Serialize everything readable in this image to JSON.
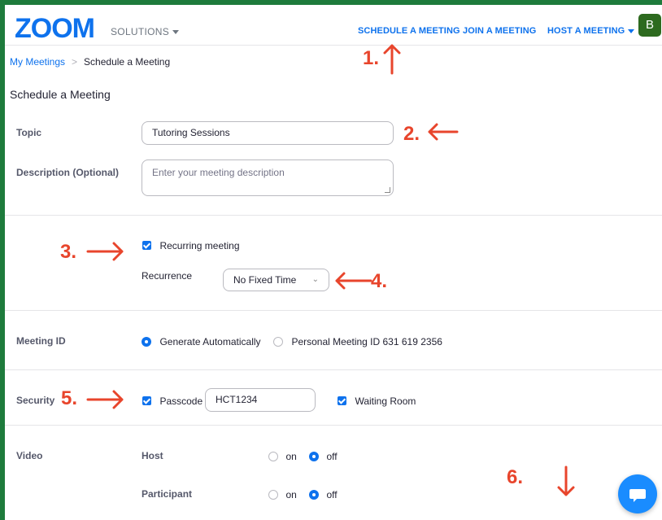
{
  "header": {
    "logo_text": "ZOOM",
    "solutions_label": "SOLUTIONS",
    "nav": {
      "schedule": "SCHEDULE A MEETING",
      "join": "JOIN A MEETING",
      "host": "HOST A MEETING"
    },
    "avatar_initial": "B"
  },
  "breadcrumb": {
    "home": "My Meetings",
    "separator": ">",
    "current": "Schedule a Meeting"
  },
  "page_title": "Schedule a Meeting",
  "form": {
    "topic_label": "Topic",
    "topic_value": "Tutoring Sessions",
    "description_label": "Description (Optional)",
    "description_placeholder": "Enter your meeting description",
    "recurring_label": "Recurring meeting",
    "recurring_checked": true,
    "recurrence_label": "Recurrence",
    "recurrence_value": "No Fixed Time",
    "meeting_id_label": "Meeting ID",
    "generate_auto_label": "Generate Automatically",
    "personal_id_label": "Personal Meeting ID 631 619 2356",
    "security_label": "Security",
    "passcode_label": "Passcode",
    "passcode_value": "HCT1234",
    "waiting_room_label": "Waiting Room",
    "video_label": "Video",
    "host_label": "Host",
    "participant_label": "Participant",
    "on_label": "on",
    "off_label": "off"
  },
  "annotations": [
    "1.",
    "2.",
    "3.",
    "4.",
    "5.",
    "6."
  ],
  "colors": {
    "border_green": "#1e7b3c",
    "accent_blue": "#0e72ed",
    "annotation_red": "#e8452c",
    "avatar_green": "#2d6a1f"
  },
  "icons": {
    "chat": "chat-bubble-icon"
  }
}
